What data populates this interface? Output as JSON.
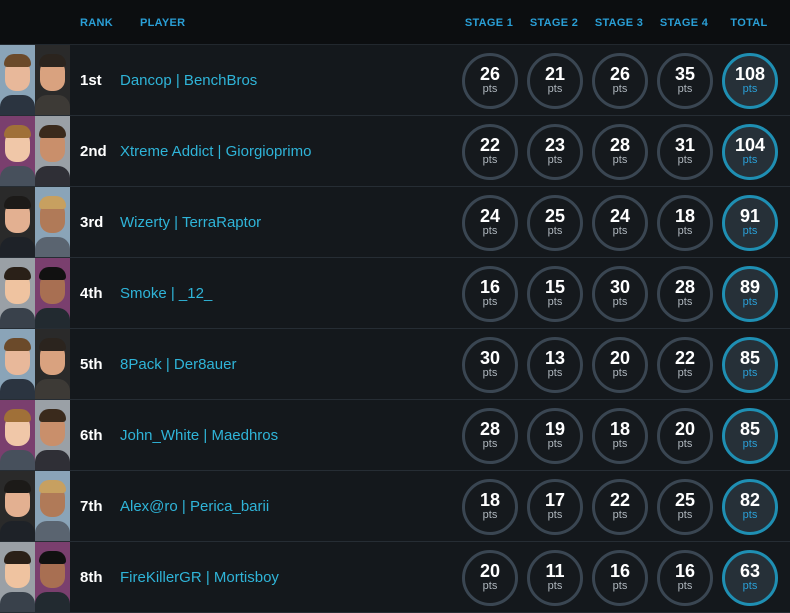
{
  "header": {
    "rank": "RANK",
    "player": "PLAYER",
    "stage1": "STAGE 1",
    "stage2": "STAGE 2",
    "stage3": "STAGE 3",
    "stage4": "STAGE 4",
    "total": "TOTAL"
  },
  "unit": "pts",
  "rows": [
    {
      "rank": "1st",
      "player": "Dancop | BenchBros",
      "s1": "26",
      "s2": "21",
      "s3": "26",
      "s4": "35",
      "total": "108"
    },
    {
      "rank": "2nd",
      "player": "Xtreme Addict | Giorgioprimo",
      "s1": "22",
      "s2": "23",
      "s3": "28",
      "s4": "31",
      "total": "104"
    },
    {
      "rank": "3rd",
      "player": "Wizerty | TerraRaptor",
      "s1": "24",
      "s2": "25",
      "s3": "24",
      "s4": "18",
      "total": "91"
    },
    {
      "rank": "4th",
      "player": "Smoke | _12_",
      "s1": "16",
      "s2": "15",
      "s3": "30",
      "s4": "28",
      "total": "89"
    },
    {
      "rank": "5th",
      "player": "8Pack | Der8auer",
      "s1": "30",
      "s2": "13",
      "s3": "20",
      "s4": "22",
      "total": "85"
    },
    {
      "rank": "6th",
      "player": "John_White | Maedhros",
      "s1": "28",
      "s2": "19",
      "s3": "18",
      "s4": "20",
      "total": "85"
    },
    {
      "rank": "7th",
      "player": "Alex@ro | Perica_barii",
      "s1": "18",
      "s2": "17",
      "s3": "22",
      "s4": "25",
      "total": "82"
    },
    {
      "rank": "8th",
      "player": "FireKillerGR | Mortisboy",
      "s1": "20",
      "s2": "11",
      "s3": "16",
      "s4": "16",
      "total": "63"
    }
  ],
  "colors": {
    "accent": "#2a9fd6",
    "player_link": "#2fb4d8",
    "background": "#14181c",
    "header_bg": "#0c0e10",
    "ring": "#3a4652",
    "total_ring": "#1f8fb3"
  },
  "icons": [
    "player-photo-left",
    "player-photo-right"
  ]
}
